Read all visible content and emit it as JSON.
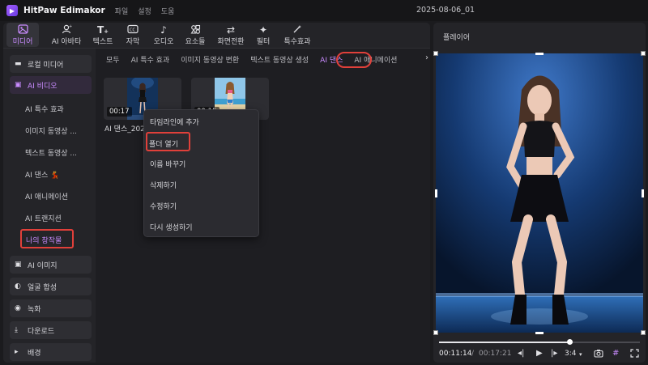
{
  "app": {
    "title": "HitPaw Edimakor",
    "menu": [
      "파일",
      "설정",
      "도움"
    ],
    "project_name": "2025-08-06_01"
  },
  "toolbar": {
    "items": [
      {
        "label": "미디어",
        "icon": "media-icon",
        "active": true
      },
      {
        "label": "AI 아바타",
        "icon": "avatar-icon",
        "active": false
      },
      {
        "label": "텍스트",
        "icon": "text-icon",
        "active": false
      },
      {
        "label": "자막",
        "icon": "subtitle-icon",
        "active": false
      },
      {
        "label": "오디오",
        "icon": "audio-icon",
        "active": false
      },
      {
        "label": "요소들",
        "icon": "elements-icon",
        "active": false
      },
      {
        "label": "화면전환",
        "icon": "transition-icon",
        "active": false
      },
      {
        "label": "필터",
        "icon": "filter-icon",
        "active": false
      },
      {
        "label": "특수효과",
        "icon": "effects-icon",
        "active": false
      }
    ]
  },
  "sidebar": {
    "local_media": "로컬 미디어",
    "ai_video": "AI 비디오",
    "sub_items": [
      "AI 특수 효과",
      "이미지 동영상 ...",
      "텍스트 동영상 ...",
      "AI 댄스 💃",
      "AI 애니메이션",
      "AI 트랜지션",
      "나의 창작물"
    ],
    "ai_image": "AI 이미지",
    "face_swap": "얼굴 합성",
    "recording": "녹화",
    "download": "다운로드",
    "background": "배경"
  },
  "tabs": {
    "items": [
      "모두",
      "AI 특수 효과",
      "이미지 동영상 변환",
      "텍스트 동영상 생성",
      "AI 댄스",
      "AI 애니메이션"
    ],
    "active": "AI 댄스"
  },
  "media": [
    {
      "time": "00:17",
      "label": "AI 댄스_2025"
    },
    {
      "time": "00:15",
      "label": ""
    }
  ],
  "context_menu": {
    "items": [
      "타임라인에 추가",
      "폴더 열기",
      "이름 바꾸기",
      "삭제하기",
      "수정하기",
      "다시 생성하기"
    ],
    "highlighted": "폴더 열기"
  },
  "player": {
    "title": "플레이어",
    "current_time": "00:11:14",
    "separator": "/",
    "total_time": "00:17:21",
    "progress": 0.65,
    "aspect_ratio": "3:4"
  },
  "colors": {
    "accent": "#c98bff",
    "highlight_box": "#e0403a",
    "panel_bg": "#242428"
  }
}
